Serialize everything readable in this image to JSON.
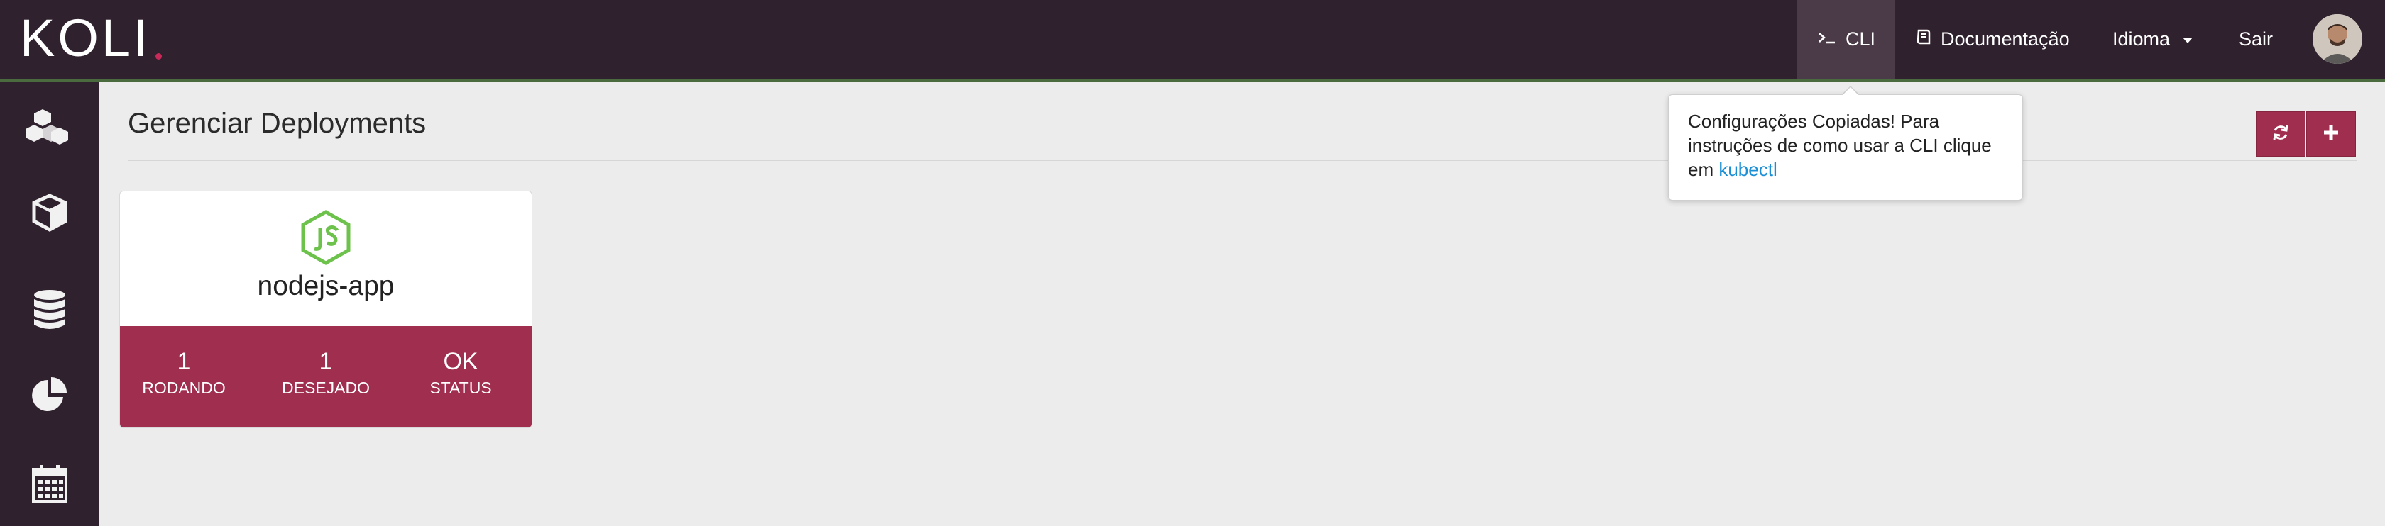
{
  "header": {
    "logo": "KOLI",
    "nav": {
      "cli_label": "CLI",
      "docs_label": "Documentação",
      "language_label": "Idioma",
      "logout_label": "Sair"
    }
  },
  "sidebar": {
    "items": [
      {
        "icon": "cubes-icon"
      },
      {
        "icon": "cube-icon"
      },
      {
        "icon": "database-icon"
      },
      {
        "icon": "pie-chart-icon"
      },
      {
        "icon": "calendar-icon"
      }
    ]
  },
  "main": {
    "title": "Gerenciar Deployments",
    "toolbar": {
      "refresh_icon": "refresh-icon",
      "add_icon": "plus-icon"
    }
  },
  "tooltip": {
    "text": "Configurações Copiadas! Para instruções de como usar a CLI clique em ",
    "link": "kubectl"
  },
  "deployments": [
    {
      "name": "nodejs-app",
      "icon": "nodejs-icon",
      "running": "1",
      "running_label": "RODANDO",
      "desired": "1",
      "desired_label": "DESEJADO",
      "status": "OK",
      "status_label": "STATUS"
    }
  ],
  "colors": {
    "topbar": "#30212f",
    "accent": "#a02e4f",
    "nodejs": "#6cc24a",
    "link": "#1b8fd6"
  }
}
